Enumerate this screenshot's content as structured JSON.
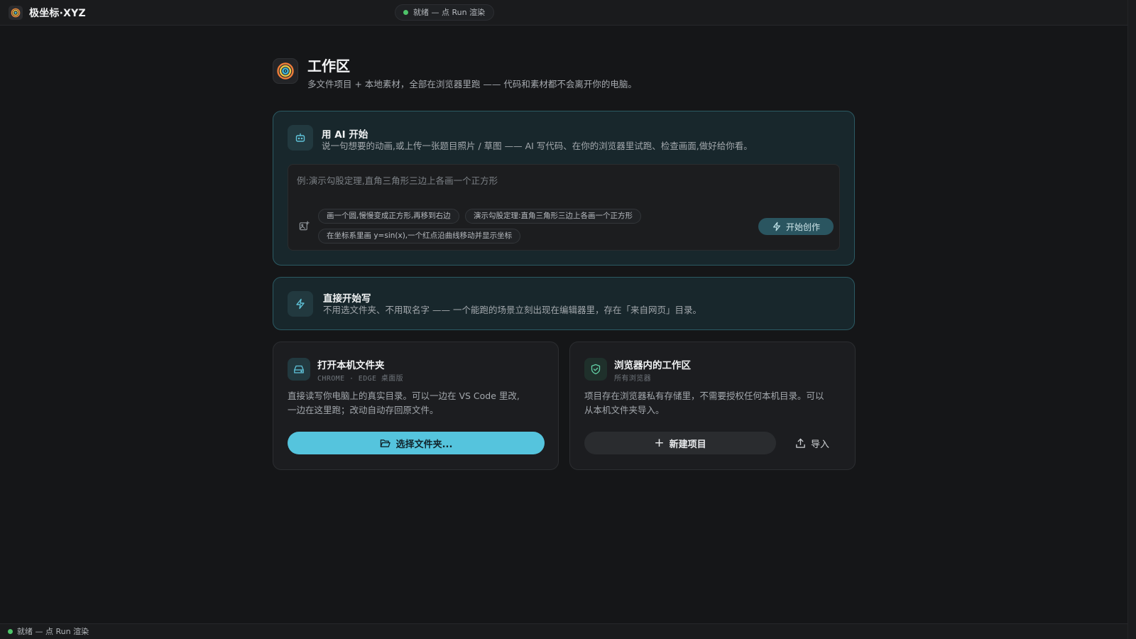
{
  "app": {
    "name": "极坐标·XYZ",
    "status": "就绪 — 点 Run 渲染"
  },
  "header": {
    "title": "工作区",
    "subtitle": "多文件项目 + 本地素材，全部在浏览器里跑 —— 代码和素材都不会离开你的电脑。"
  },
  "ai_card": {
    "title": "用 AI 开始",
    "description": "说一句想要的动画,或上传一张题目照片 / 草图 —— AI 写代码、在你的浏览器里试跑、检查画面,做好给你看。",
    "prompt_placeholder": "例:演示勾股定理,直角三角形三边上各画一个正方形",
    "prompt_value": "",
    "suggestions": [
      "画一个圆,慢慢变成正方形,再移到右边",
      "演示勾股定理:直角三角形三边上各画一个正方形",
      "在坐标系里画 y=sin(x),一个红点沿曲线移动并显示坐标"
    ],
    "start_label": "开始创作"
  },
  "direct_card": {
    "title": "直接开始写",
    "description": "不用选文件夹、不用取名字 —— 一个能跑的场景立刻出现在编辑器里，存在「来自网页」目录。"
  },
  "folder_card": {
    "title": "打开本机文件夹",
    "meta": "CHROME · EDGE 桌面版",
    "description_line1": "直接读写你电脑上的真实目录。可以一边在 VS Code 里改,",
    "description_line2": "一边在这里跑；改动自动存回原文件。",
    "button_label": "选择文件夹..."
  },
  "browser_card": {
    "title": "浏览器内的工作区",
    "meta": "所有浏览器",
    "description_line1": "项目存在浏览器私有存储里，不需要授权任何本机目录。可以",
    "description_line2": "从本机文件夹导入。",
    "new_label": "新建项目",
    "import_label": "导入"
  },
  "colors": {
    "accent": "#55c4dd",
    "status_ok": "#4ec46a",
    "card_accent_border": "#2b5a63"
  }
}
